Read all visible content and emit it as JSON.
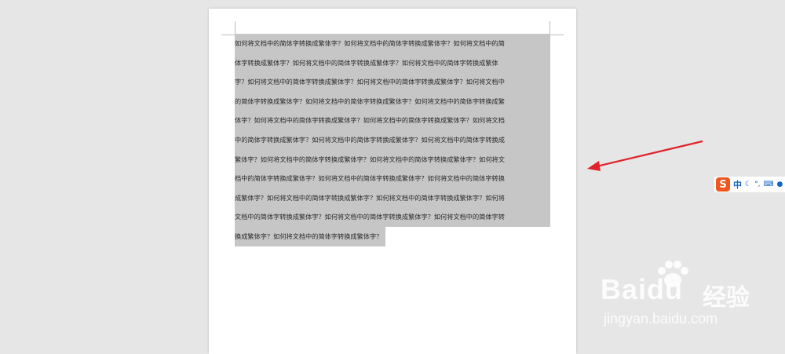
{
  "document": {
    "lines": [
      "如何将文档中的简体字转换成繁体字？如何将文档中的简体字转换成繁体字？如何将文档中的简",
      "体字转换成繁体字？如何将文档中的简体字转换成繁体字？如何将文档中的简体字转换成繁体",
      "字？如何将文档中的简体字转换成繁体字？如何将文档中的简体字转换成繁体字？如何将文档中",
      "的简体字转换成繁体字？如何将文档中的简体字转换成繁体字？如何将文档中的简体字转换成繁",
      "体字？如何将文档中的简体字转换成繁体字？如何将文档中的简体字转换成繁体字？如何将文档",
      "中的简体字转换成繁体字？如何将文档中的简体字转换成繁体字？如何将文档中的简体字转换成",
      "繁体字？如何将文档中的简体字转换成繁体字？如何将文档中的简体字转换成繁体字？如何将文",
      "档中的简体字转换成繁体字？如何将文档中的简体字转换成繁体字？如何将文档中的简体字转换",
      "成繁体字？如何将文档中的简体字转换成繁体字？如何将文档中的简体字转换成繁体字？如何将",
      "文档中的简体字转换成繁体字？如何将文档中的简体字转换成繁体字？如何将文档中的简体字转",
      "换成繁体字？如何将文档中的简体字转换成繁体字？"
    ],
    "selection_color": "#c6c6c6"
  },
  "ime_toolbar": {
    "logo": "S",
    "mode": "中",
    "icons": [
      "moon-icon",
      "punctuation-icon",
      "keyboard-icon",
      "user-icon"
    ]
  },
  "watermark": {
    "brand": "Bai",
    "brand_suffix": "du",
    "cn": "经验",
    "url": "jingyan.baidu.com"
  },
  "annotation": {
    "arrow_color": "#e0232b"
  }
}
